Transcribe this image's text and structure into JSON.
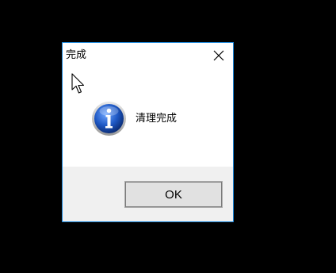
{
  "dialog": {
    "title": "完成",
    "message": "清理完成",
    "ok_label": "OK",
    "icon": "info-icon",
    "close_icon": "close-icon"
  },
  "colors": {
    "screen_background": "#000000",
    "dialog_border": "#1883d7",
    "dialog_background": "#ffffff",
    "footer_background": "#f0f0f0",
    "button_background": "#e1e1e1",
    "info_icon_blue": "#1e58c4"
  }
}
